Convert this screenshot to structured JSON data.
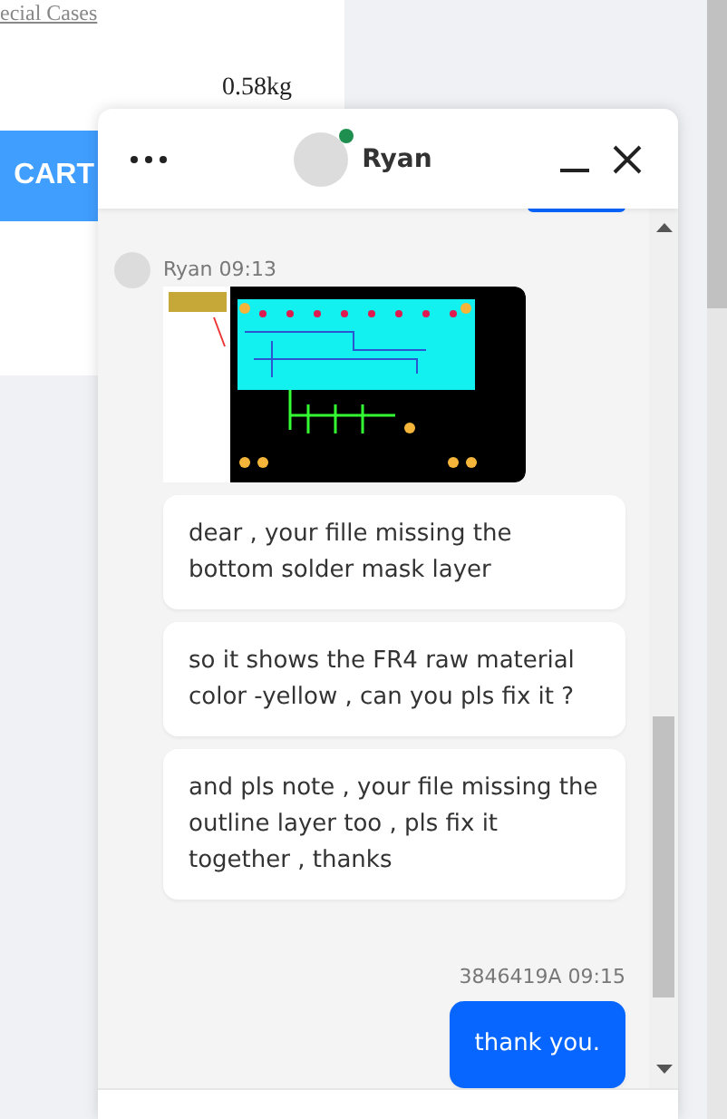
{
  "page": {
    "link": "ecial Cases",
    "weight": "0.58kg",
    "cart_button": "CART"
  },
  "chat": {
    "contact": {
      "name": "Ryan",
      "online": true
    },
    "messages": [
      {
        "kind": "outgoing-cut"
      },
      {
        "kind": "incoming-image",
        "sender": "Ryan",
        "time": "09:13"
      },
      {
        "kind": "incoming-text",
        "text": "dear , your fille missing the bottom solder mask layer"
      },
      {
        "kind": "incoming-text",
        "text": "so it shows the FR4 raw material color -yellow , can you pls fix it ?"
      },
      {
        "kind": "incoming-text",
        "text": "and pls note , your file missing the outline layer too , pls fix it together , thanks"
      },
      {
        "kind": "outgoing-text",
        "sender": "3846419A",
        "time": "09:15",
        "text": "thank you."
      }
    ]
  }
}
